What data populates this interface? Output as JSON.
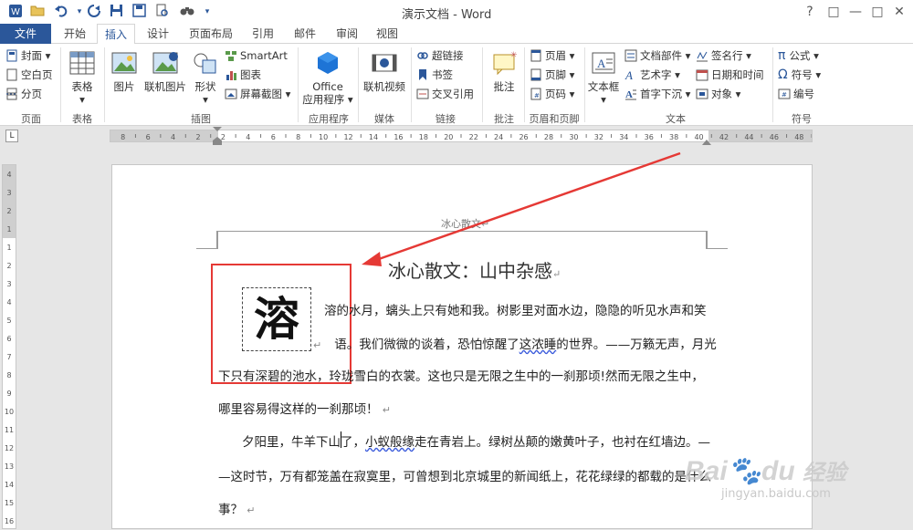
{
  "window": {
    "title": "演示文档 - Word",
    "controls": [
      "?",
      "□",
      "—",
      "□",
      "✕"
    ]
  },
  "tabs": [
    "文件",
    "开始",
    "插入",
    "设计",
    "页面布局",
    "引用",
    "邮件",
    "审阅",
    "视图"
  ],
  "ribbon": {
    "pages": {
      "label": "页面",
      "items": [
        "封面",
        "空白页",
        "分页"
      ]
    },
    "tables": {
      "label": "表格",
      "item": "表格"
    },
    "illustrations": {
      "label": "插图",
      "items": [
        "图片",
        "联机图片",
        "形状"
      ],
      "small": [
        "SmartArt",
        "图表",
        "屏幕截图"
      ]
    },
    "apps": {
      "label": "应用程序",
      "item_line1": "Office",
      "item_line2": "应用程序"
    },
    "media": {
      "label": "媒体",
      "item": "联机视频"
    },
    "links": {
      "label": "链接",
      "items": [
        "超链接",
        "书签",
        "交叉引用"
      ]
    },
    "comments": {
      "label": "批注",
      "item": "批注"
    },
    "header_footer": {
      "label": "页眉和页脚",
      "items": [
        "页眉",
        "页脚",
        "页码"
      ]
    },
    "text": {
      "label": "文本",
      "textbox": "文本框",
      "items": [
        "文档部件",
        "艺术字",
        "首字下沉",
        "签名行",
        "日期和时间",
        "对象"
      ]
    },
    "symbols": {
      "label": "符号",
      "items": [
        "公式",
        "符号",
        "编号"
      ]
    }
  },
  "ruler": {
    "ticks": [
      "8",
      "6",
      "4",
      "2",
      "2",
      "4",
      "6",
      "8",
      "10",
      "12",
      "14",
      "16",
      "18",
      "20",
      "22",
      "24",
      "26",
      "28",
      "30",
      "32",
      "34",
      "36",
      "38",
      "40",
      "42",
      "44",
      "46",
      "48"
    ],
    "vticks": [
      "4",
      "3",
      "2",
      "1",
      "1",
      "2",
      "3",
      "4",
      "5",
      "6",
      "7",
      "8",
      "9",
      "10",
      "11",
      "12",
      "13",
      "14",
      "15",
      "16"
    ],
    "tab_marker": "L"
  },
  "document": {
    "header_text": "冰心散文",
    "heading": "冰心散文：山中杂感",
    "dropcap": "溶",
    "p1_line1": "溶的水月，螭头上只有她和我。树影里对面水边，隐隐的听见水声和笑",
    "p1_line2a": "语。我们微微的谈着，恐怕惊醒了",
    "p1_line2_underlined": "这浓睡",
    "p1_line2b": "的世界。——万籁无声，月光",
    "p1_line3": "下只有深碧的池水，玲珑雪白的衣裳。这也只是无限之生中的一刹那顷!然而无限之生中，",
    "p1_line4": "哪里容易得这样的一刹那顷！",
    "p2_line1a": "夕阳里，牛羊下山了，",
    "p2_line1_underlined": "小蚁般缘",
    "p2_line1b": "走在青岩上。绿树丛颠的嫩黄叶子，也衬在红墙边。—",
    "p2_line2": "—这时节，万有都笼盖在寂寞里，可曾想到北京城里的新闻纸上，花花绿绿的都载的是什么",
    "p2_line3": "事？",
    "para_mark": "↵"
  },
  "watermark": {
    "brand": "Bai",
    "brand2": "du",
    "jingyan": "经验",
    "url": "jingyan.baidu.com"
  },
  "colors": {
    "accent": "#2b579a",
    "annotation": "#e53935"
  }
}
